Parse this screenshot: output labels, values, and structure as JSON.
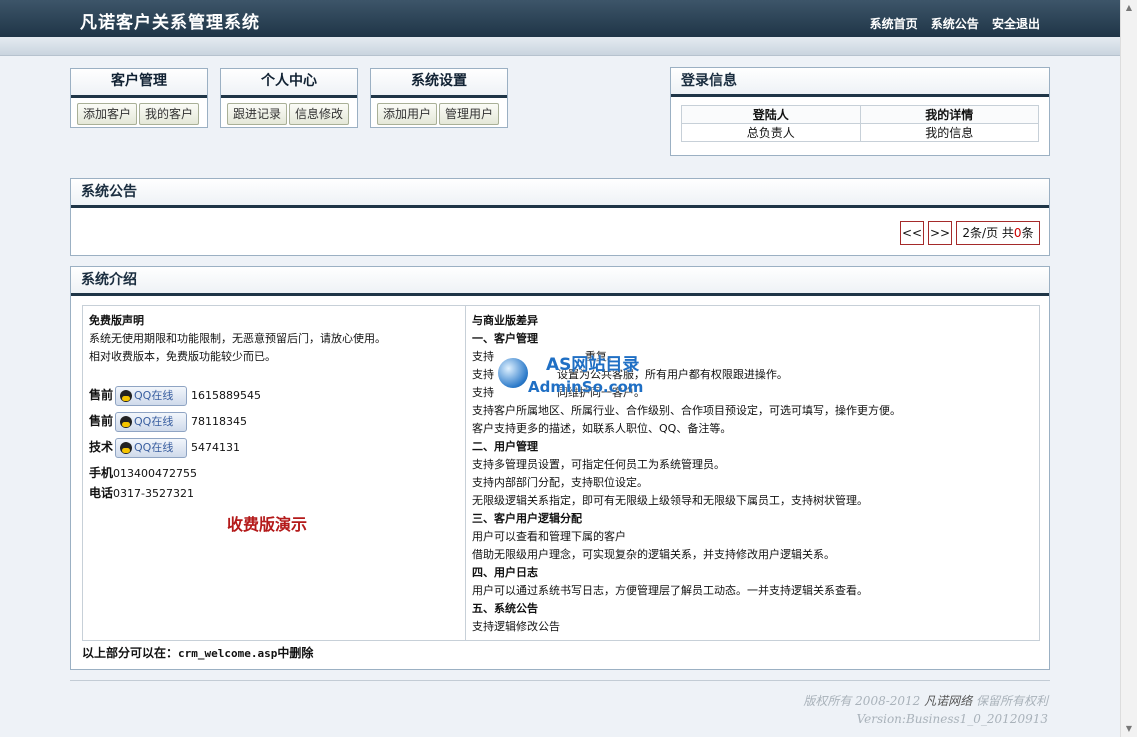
{
  "app": {
    "title": "凡诺客户关系管理系统"
  },
  "top_nav": [
    "系统首页",
    "系统公告",
    "安全退出"
  ],
  "menus": [
    {
      "title": "客户管理",
      "items": [
        "添加客户",
        "我的客户"
      ]
    },
    {
      "title": "个人中心",
      "items": [
        "跟进记录",
        "信息修改"
      ]
    },
    {
      "title": "系统设置",
      "items": [
        "添加用户",
        "管理用户"
      ]
    }
  ],
  "login": {
    "title": "登录信息",
    "headers": [
      "登陆人",
      "我的详情"
    ],
    "row": [
      "总负责人",
      "我的信息"
    ]
  },
  "notice": {
    "title": "系统公告",
    "prev": "<<",
    "next": ">>",
    "per_page": "2条/页 共",
    "count": "0",
    "unit": "条"
  },
  "intro": {
    "title": "系统介绍",
    "free_title": "免费版声明",
    "free_lines": [
      "系统无使用期限和功能限制，无恶意预留后门，请放心使用。",
      "相对收费版本，免费版功能较少而已。"
    ],
    "contacts": [
      {
        "label": "售前",
        "qq": "QQ在线",
        "number": "1615889545"
      },
      {
        "label": "售前",
        "qq": "QQ在线",
        "number": "78118345"
      },
      {
        "label": "技术",
        "qq": "QQ在线",
        "number": "5474131"
      }
    ],
    "phone_label": "手机",
    "phone": "013400472755",
    "tel_label": "电话",
    "tel": "0317-3527321",
    "paid_demo": "收费版演示",
    "diff_title": "与商业版差异",
    "diff_lines": [
      {
        "text": "一、客户管理",
        "bold": true
      },
      {
        "text": "支持                          重复。",
        "bold": false
      },
      {
        "text": "支持                  设置为公共客服，所有用户都有权限跟进操作。",
        "bold": false
      },
      {
        "text": "支持                  同维护同一客户。",
        "bold": false
      },
      {
        "text": "支持客户所属地区、所属行业、合作级别、合作项目预设定，可选可填写，操作更方便。",
        "bold": false
      },
      {
        "text": "客户支持更多的描述，如联系人职位、QQ、备注等。",
        "bold": false
      },
      {
        "text": "二、用户管理",
        "bold": true
      },
      {
        "text": "支持多管理员设置，可指定任何员工为系统管理员。",
        "bold": false
      },
      {
        "text": "支持内部部门分配，支持职位设定。",
        "bold": false
      },
      {
        "text": "无限级逻辑关系指定，即可有无限级上级领导和无限级下属员工，支持树状管理。",
        "bold": false
      },
      {
        "text": "三、客户用户逻辑分配",
        "bold": true
      },
      {
        "text": "用户可以查看和管理下属的客户",
        "bold": false
      },
      {
        "text": "借助无限级用户理念，可实现复杂的逻辑关系，并支持修改用户逻辑关系。",
        "bold": false
      },
      {
        "text": "四、用户日志",
        "bold": true
      },
      {
        "text": "用户可以通过系统书写日志，方便管理层了解员工动态。一并支持逻辑关系查看。",
        "bold": false
      },
      {
        "text": "五、系统公告",
        "bold": true
      },
      {
        "text": "支持逻辑修改公告",
        "bold": false
      }
    ],
    "note_prefix": "以上部分可以在：",
    "note_file": "crm_welcome.asp",
    "note_suffix": "中删除"
  },
  "watermark": {
    "top": "AS网站目录",
    "bottom": "AdminSo.com"
  },
  "footer": {
    "copyright_prefix": "版权所有 2008-2012",
    "company": "凡诺网络",
    "rights": "保留所有权利",
    "version": "Version:Business1_0_20120913"
  }
}
